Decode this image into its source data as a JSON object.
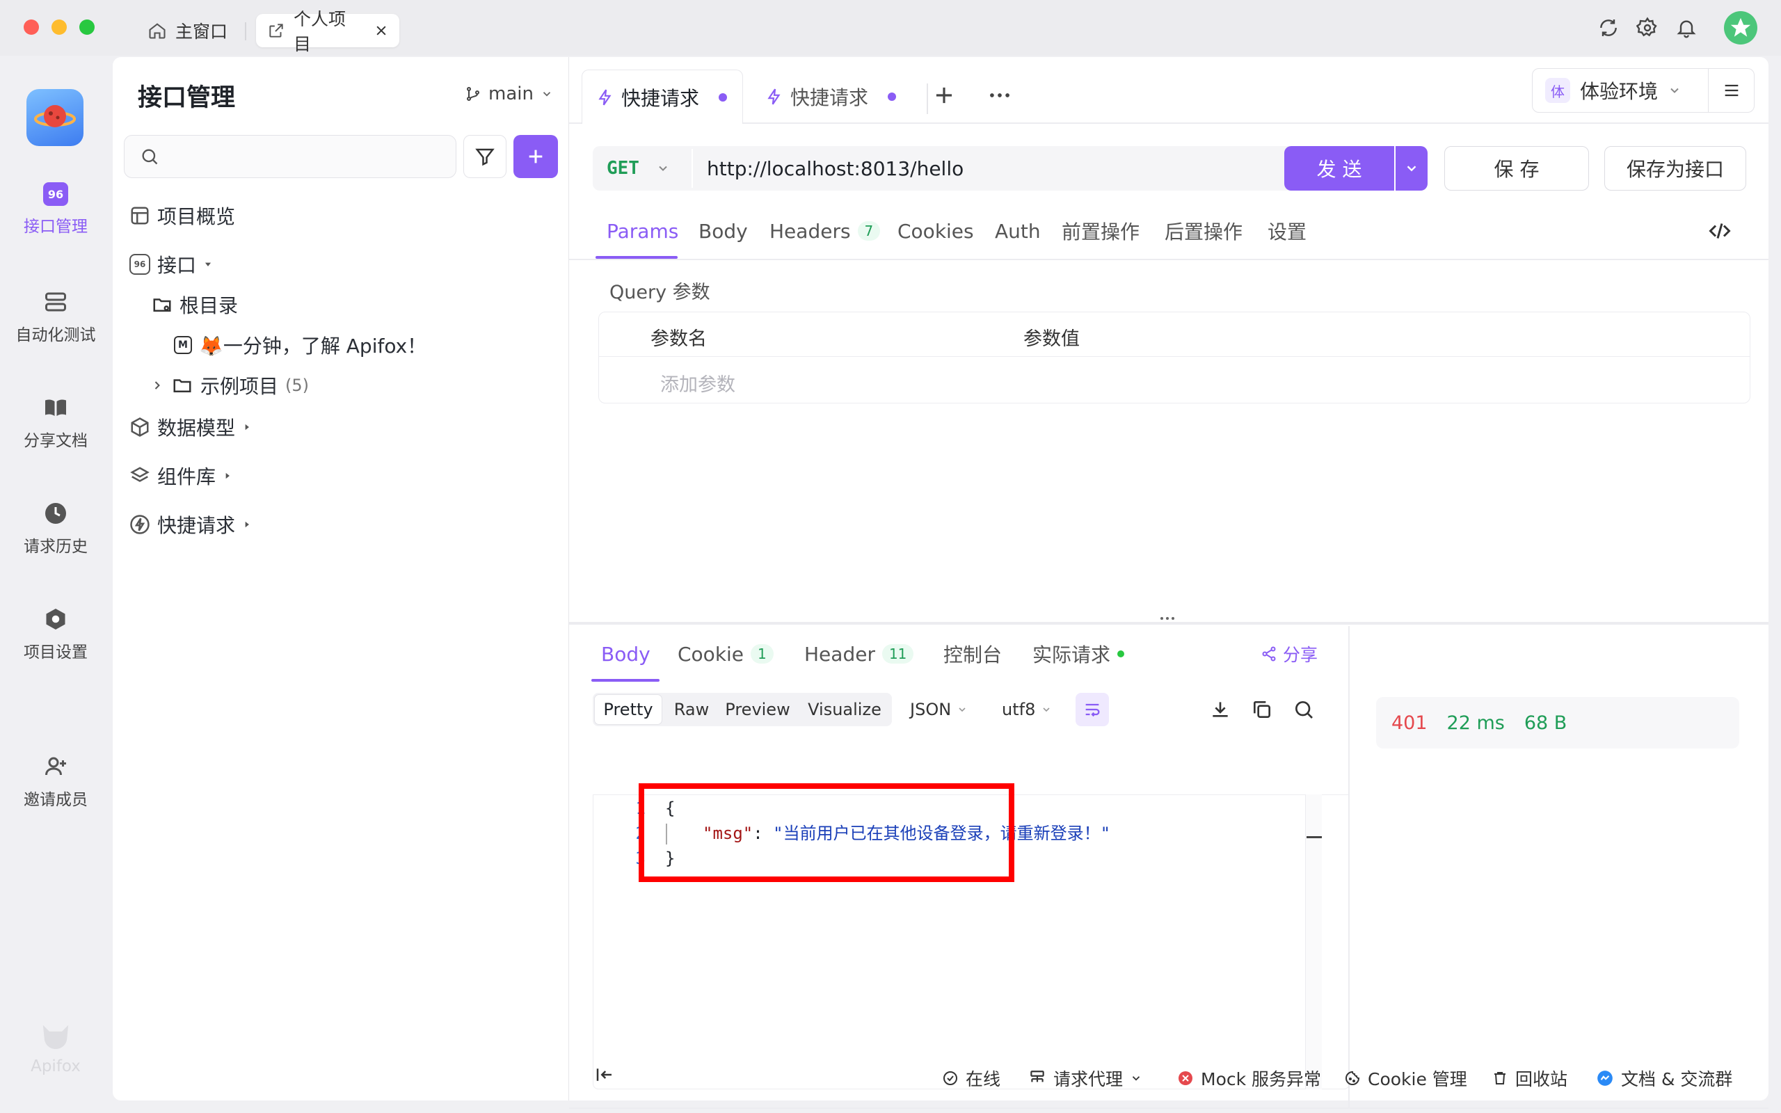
{
  "window": {
    "tabs": [
      {
        "label": "主窗口"
      },
      {
        "label": "个人项目"
      }
    ]
  },
  "rail": {
    "items": [
      {
        "label": "接口管理"
      },
      {
        "label": "自动化测试"
      },
      {
        "label": "分享文档"
      },
      {
        "label": "请求历史"
      },
      {
        "label": "项目设置"
      },
      {
        "label": "邀请成员"
      }
    ],
    "brand": "Apifox"
  },
  "sidebar": {
    "title": "接口管理",
    "branch": "main",
    "search_placeholder": "",
    "items": {
      "overview": "项目概览",
      "api": "接口",
      "root": "根目录",
      "doc": "🦊一分钟，了解 Apifox！",
      "examples": "示例项目",
      "examples_count": "(5)",
      "schemas": "数据模型",
      "components": "组件库",
      "quick": "快捷请求"
    }
  },
  "request": {
    "tabs": [
      {
        "label": "快捷请求"
      },
      {
        "label": "快捷请求"
      }
    ],
    "env_badge": "体",
    "env": "体验环境",
    "method": "GET",
    "url": "http://localhost:8013/hello",
    "send": "发 送",
    "save": "保 存",
    "save_as": "保存为接口",
    "param_tabs": {
      "params": "Params",
      "body": "Body",
      "headers": "Headers",
      "headers_count": "7",
      "cookies": "Cookies",
      "auth": "Auth",
      "pre": "前置操作",
      "post": "后置操作",
      "settings": "设置"
    },
    "query_title": "Query 参数",
    "col_name": "参数名",
    "col_value": "参数值",
    "add_param": "添加参数"
  },
  "response": {
    "tabs": {
      "body": "Body",
      "cookie": "Cookie",
      "cookie_count": "1",
      "header": "Header",
      "header_count": "11",
      "console": "控制台",
      "actual": "实际请求"
    },
    "share": "分享",
    "views": {
      "pretty": "Pretty",
      "raw": "Raw",
      "preview": "Preview",
      "visualize": "Visualize"
    },
    "format": "JSON",
    "encoding": "utf8",
    "lines": [
      "1",
      "2",
      "3"
    ],
    "json_open": "{",
    "json_key": "\"msg\"",
    "json_colon": ": ",
    "json_value": "\"当前用户已在其他设备登录，请重新登录！\"",
    "json_close": "}",
    "status": "401",
    "time": "22 ms",
    "size": "68 B"
  },
  "footer": {
    "online": "在线",
    "proxy": "请求代理",
    "mock": "Mock 服务异常",
    "cookie": "Cookie 管理",
    "trash": "回收站",
    "docs": "文档 & 交流群"
  },
  "colors": {
    "accent": "#8a5cf5",
    "error": "#e5484d",
    "success": "#1f9d57",
    "highlight": "#ff0000"
  }
}
